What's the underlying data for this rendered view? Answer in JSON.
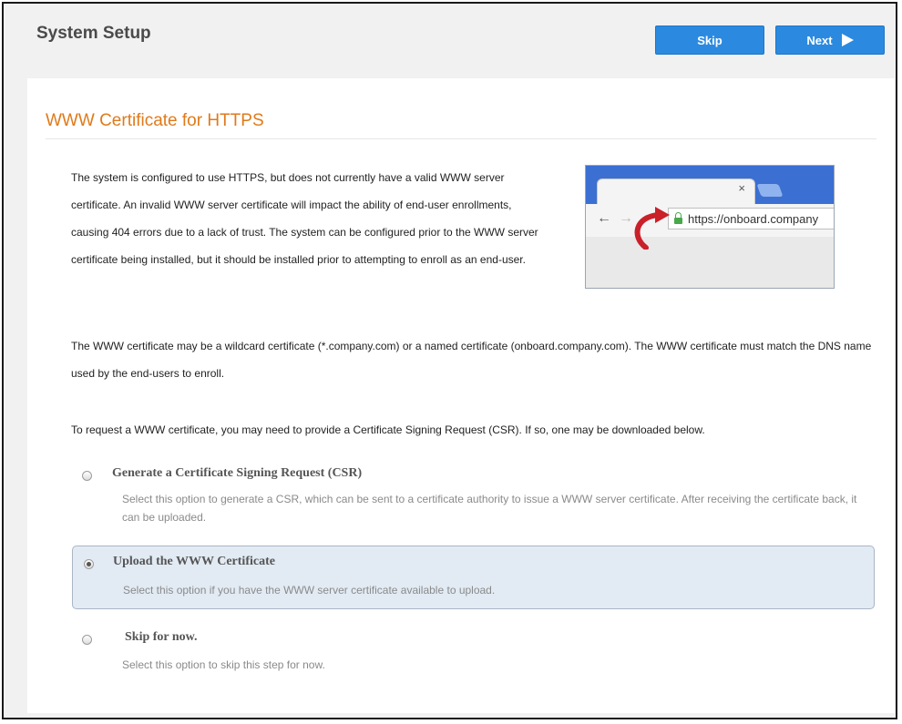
{
  "header": {
    "title": "System Setup",
    "skip_label": "Skip",
    "next_label": "Next"
  },
  "section": {
    "title": "WWW Certificate for HTTPS",
    "paragraphs": [
      "The system is configured to use HTTPS, but does not currently have a valid WWW server certificate. An invalid WWW server certificate will impact the ability of end-user enrollments, causing 404 errors due to a lack of trust. The system can be configured prior to the WWW server certificate being installed, but it should be installed prior to attempting to enroll as an end-user.",
      "The WWW certificate may be a wildcard certificate (*.company.com) or a named certificate (onboard.company.com). The WWW certificate must match the DNS name used by the end-users to enroll.",
      "To request a WWW certificate, you may need to provide a Certificate Signing Request (CSR). If so, one may be downloaded below."
    ]
  },
  "illustration": {
    "tab_close": "×",
    "url": "https://onboard.company"
  },
  "options": [
    {
      "label": "Generate a Certificate Signing Request (CSR)",
      "description": "Select this option to generate a CSR, which can be sent to a certificate authority to issue a WWW server certificate. After receiving the certificate back, it can be uploaded.",
      "selected": false
    },
    {
      "label": "Upload the WWW Certificate",
      "description": "Select this option if you have the WWW server certificate available to upload.",
      "selected": true
    },
    {
      "label": "Skip for now.",
      "description": "Select this option to skip this step for now.",
      "selected": false
    }
  ],
  "colors": {
    "button_blue": "#2b8ae0",
    "section_title_orange": "#e07a1a",
    "selected_option_bg": "#e2ebf4"
  }
}
